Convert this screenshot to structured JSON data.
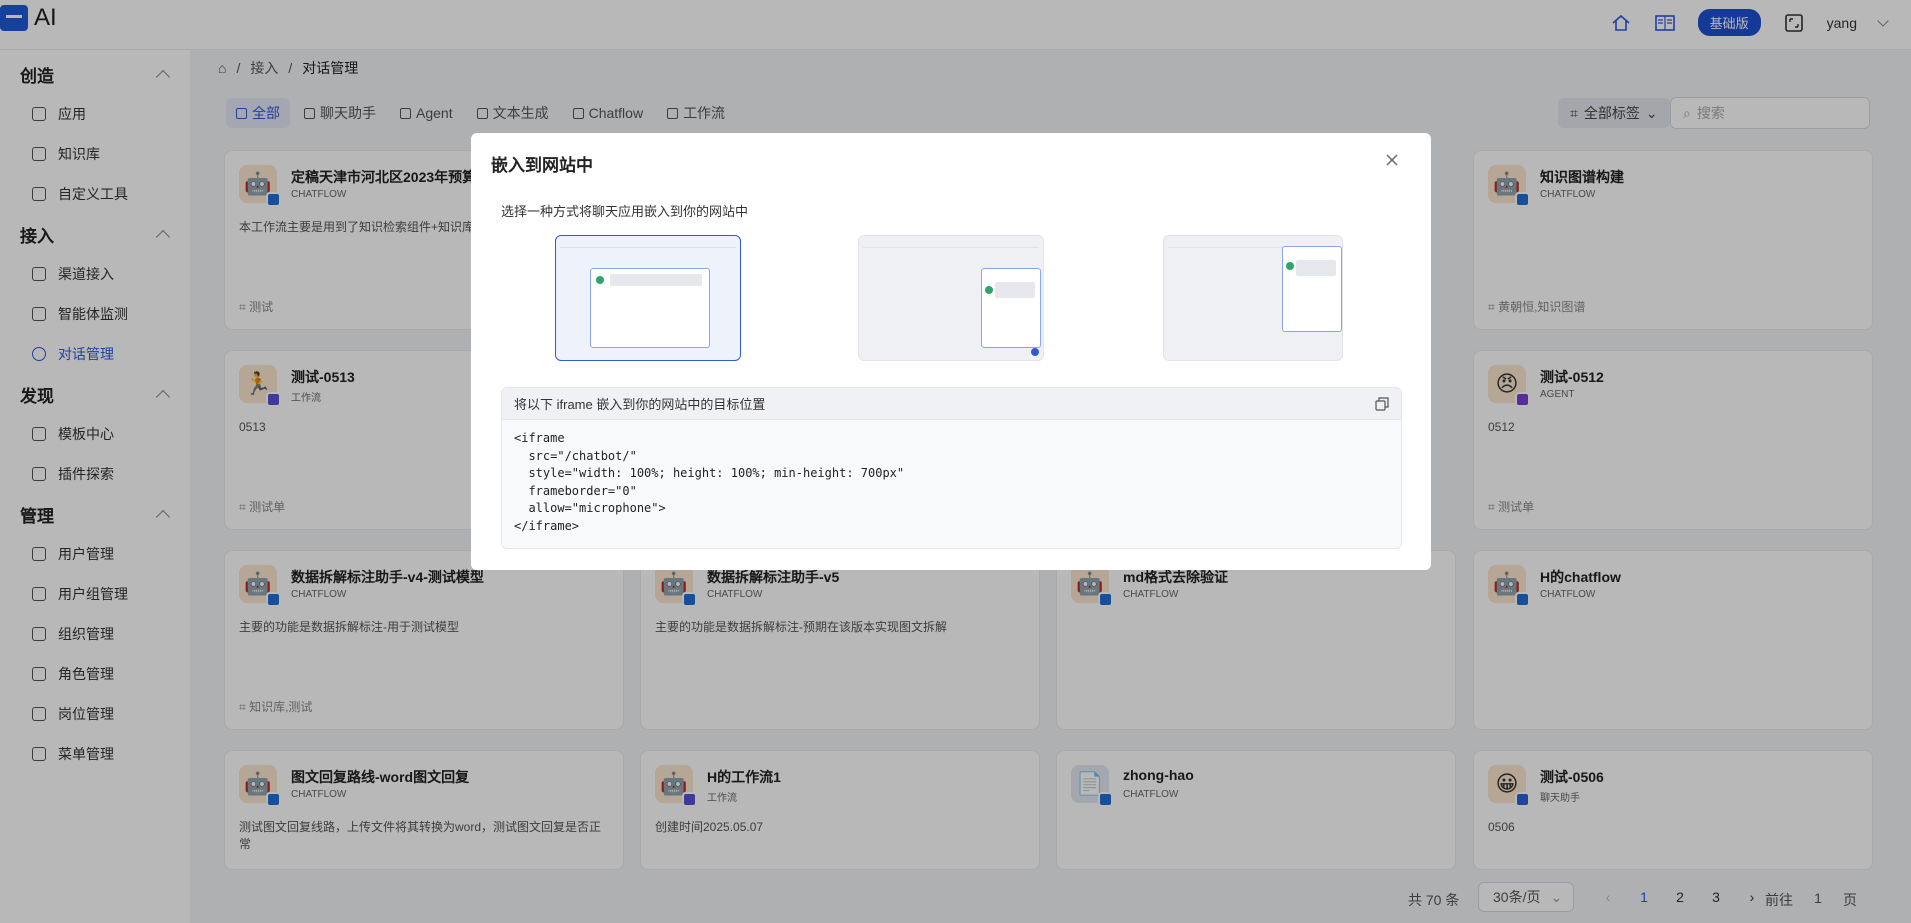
{
  "app": {
    "logo_text": "AI",
    "plan_badge": "基础版",
    "username": "yang"
  },
  "icons": {
    "home": "home-icon",
    "docs": "book-icon",
    "fullscreen": "fullscreen-icon"
  },
  "sidebar": {
    "sections": [
      {
        "title": "创造",
        "items": [
          {
            "label": "应用",
            "icon": "app-icon"
          },
          {
            "label": "知识库",
            "icon": "book-icon"
          },
          {
            "label": "自定义工具",
            "icon": "tool-icon"
          }
        ]
      },
      {
        "title": "接入",
        "items": [
          {
            "label": "渠道接入",
            "icon": "link-icon"
          },
          {
            "label": "智能体监测",
            "icon": "monitor-icon"
          },
          {
            "label": "对话管理",
            "icon": "chat-icon",
            "active": true
          }
        ]
      },
      {
        "title": "发现",
        "items": [
          {
            "label": "模板中心",
            "icon": "template-icon"
          },
          {
            "label": "插件探索",
            "icon": "plugin-icon"
          }
        ]
      },
      {
        "title": "管理",
        "items": [
          {
            "label": "用户管理",
            "icon": "user-icon"
          },
          {
            "label": "用户组管理",
            "icon": "user-group-icon"
          },
          {
            "label": "组织管理",
            "icon": "org-icon"
          },
          {
            "label": "角色管理",
            "icon": "role-icon"
          },
          {
            "label": "岗位管理",
            "icon": "position-icon"
          },
          {
            "label": "菜单管理",
            "icon": "menu-icon"
          }
        ]
      }
    ]
  },
  "breadcrumb": {
    "sep": "/",
    "level1": "接入",
    "current": "对话管理"
  },
  "tabs": [
    "全部",
    "聊天助手",
    "Agent",
    "文本生成",
    "Chatflow",
    "工作流"
  ],
  "filter": {
    "label": "全部标签"
  },
  "search": {
    "placeholder": "搜索"
  },
  "cards": [
    {
      "name": "定稿天津市河北区2023年预算",
      "type": "CHATFLOW",
      "desc": "本工作流主要是用到了知识检索组件+知识库能",
      "tag": "测试",
      "avatar": "🤖"
    },
    {
      "name": "知识图谱构建",
      "type": "CHATFLOW",
      "desc": "",
      "tag": "黄朝恒,知识图谱",
      "avatar": "🤖"
    },
    {
      "name": "测试-0513",
      "type": "工作流",
      "desc": "0513",
      "tag": "测试单",
      "avatar": "🏃"
    },
    {
      "name": "测试-0512",
      "type": "AGENT",
      "desc": "0512",
      "tag": "测试单",
      "avatar": "😠"
    },
    {
      "name": "数据拆解标注助手-v4-测试模型",
      "type": "CHATFLOW",
      "desc": "主要的功能是数据拆解标注-用于测试模型",
      "tag": "知识库,测试",
      "avatar": "🤖"
    },
    {
      "name": "数据拆解标注助手-v5",
      "type": "CHATFLOW",
      "desc": "主要的功能是数据拆解标注-预期在该版本实现图文拆解",
      "tag": "",
      "avatar": "🤖"
    },
    {
      "name": "md格式去除验证",
      "type": "CHATFLOW",
      "desc": "",
      "tag": "",
      "avatar": "🤖"
    },
    {
      "name": "H的chatflow",
      "type": "CHATFLOW",
      "desc": "",
      "tag": "",
      "avatar": "🤖"
    },
    {
      "name": "图文回复路线-word图文回复",
      "type": "CHATFLOW",
      "desc": "测试图文回复线路，上传文件将其转换为word，测试图文回复是否正常",
      "tag": "",
      "avatar": "🤖"
    },
    {
      "name": "H的工作流1",
      "type": "工作流",
      "desc": "创建时间2025.05.07",
      "tag": "",
      "avatar": "🤖"
    },
    {
      "name": "zhong-hao",
      "type": "CHATFLOW",
      "desc": "",
      "tag": "",
      "avatar": "📄"
    },
    {
      "name": "测试-0506",
      "type": "聊天助手",
      "desc": "0506",
      "tag": "",
      "avatar": "😀"
    }
  ],
  "pagination": {
    "total": "共 70 条",
    "page_size": "30条/页",
    "pages": [
      "1",
      "2",
      "3"
    ],
    "goto_prefix": "前往",
    "goto_value": "1",
    "goto_suffix": "页"
  },
  "modal": {
    "title": "嵌入到网站中",
    "subtitle": "选择一种方式将聊天应用嵌入到你的网站中",
    "code_header": "将以下 iframe 嵌入到你的网站中的目标位置",
    "code": "<iframe\n  src=\"/chatbot/\"\n  style=\"width: 100%; height: 100%; min-height: 700px\"\n  frameborder=\"0\"\n  allow=\"microphone\">\n</iframe>"
  }
}
